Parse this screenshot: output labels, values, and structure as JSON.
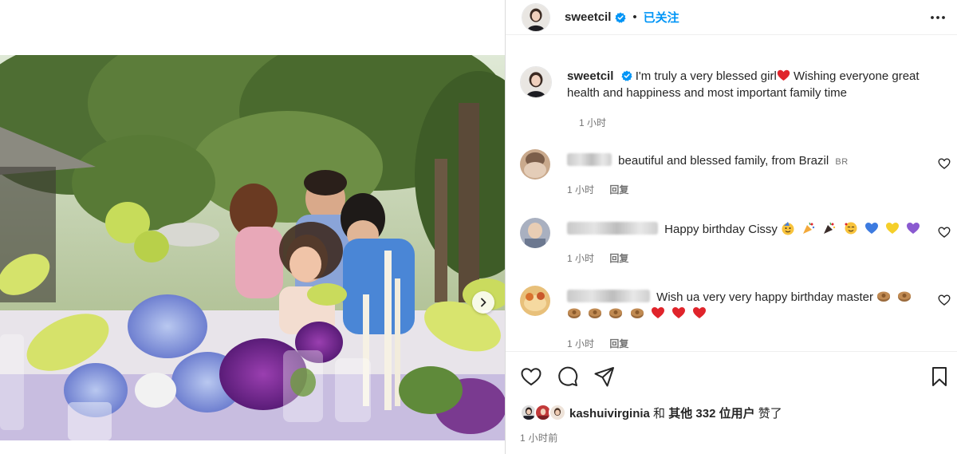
{
  "post": {
    "username": "sweetcil",
    "follow_status": "已关注",
    "caption": "I'm truly a very blessed girl",
    "caption_rest": " Wishing everyone great health and happiness and most important family time",
    "caption_time": "1 小时"
  },
  "comments": [
    {
      "text": "beautiful and blessed family, from Brazil",
      "region": "BR",
      "time": "1 小时",
      "reply": "回复",
      "emojis": []
    },
    {
      "text": "Happy birthday Cissy",
      "region": "",
      "time": "1 小时",
      "reply": "回复",
      "emojis": [
        "partying-face",
        "party-popper",
        "party-popper",
        "smiling-hearts",
        "blue-heart",
        "yellow-heart",
        "purple-heart"
      ]
    },
    {
      "text": "Wish ua very very happy birthday master",
      "region": "",
      "time": "1 小时",
      "reply": "回复",
      "emojis": [
        "mooncake",
        "mooncake",
        "mooncake",
        "mooncake",
        "mooncake",
        "mooncake",
        "red-heart",
        "red-heart",
        "red-heart"
      ]
    }
  ],
  "likes": {
    "first_liker": "kashuivirginia",
    "conjunction": "和",
    "others": "其他 332 位用户",
    "suffix": "赞了"
  },
  "timestamp": "1 小时前",
  "colors": {
    "accent": "#0095f6",
    "verified": "#0095f6",
    "heart": "#e0242b",
    "text": "#262626",
    "muted": "#737373"
  },
  "icons": {
    "like": "heart-outline-icon",
    "comment": "comment-icon",
    "share": "send-icon",
    "save": "bookmark-icon",
    "more": "more-horizontal-icon",
    "next": "chevron-right-icon"
  }
}
